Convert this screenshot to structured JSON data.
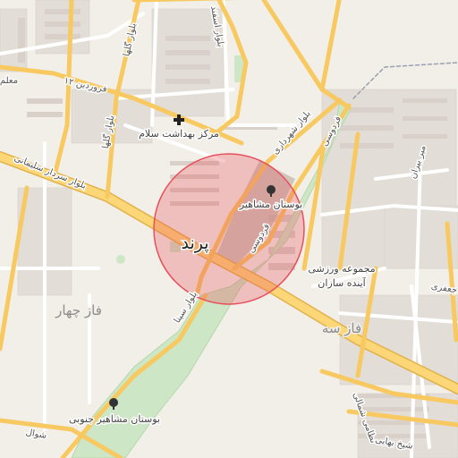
{
  "map": {
    "focus_place": "پرند",
    "focus_circle_color": "#e8505b",
    "districts": {
      "faz_chahar": "فاز چهار",
      "faz_se": "فاز سه"
    },
    "pois": {
      "health_center": "مرکز بهداشت سلام",
      "mashahir_park": "بوستان مشاهیر",
      "mashahir_south_park": "بوستان مشاهیر جنوبی",
      "sports_complex_line1": "مجموعه ورزشی",
      "sports_complex_line2": "آینده سازان"
    },
    "streets": {
      "farvardin_12": "۱۲ فروردین",
      "bolvar_golha_1": "بلوار گلها",
      "bolvar_golha_2": "بلوار گلها",
      "bolvar_esfand": "بلوار اسفند",
      "bolvar_shahrdari": "بلوار شهرداری",
      "ferdowsi_1": "فردوسی",
      "ferdowsi_2": "فردوسی",
      "sardar_soleimani": "بلوار سردار سلیمانی",
      "freeway": "آزادراه",
      "mir_beiran": "میر بیران",
      "jafari": "جعفری",
      "bolvar_sina": "بلوار سینا",
      "nezami_ganjavi": "نظامی شمالی",
      "sheikh_bahaei": "شیخ بهایی",
      "shavval": "شوال",
      "maali": "معلم"
    }
  }
}
